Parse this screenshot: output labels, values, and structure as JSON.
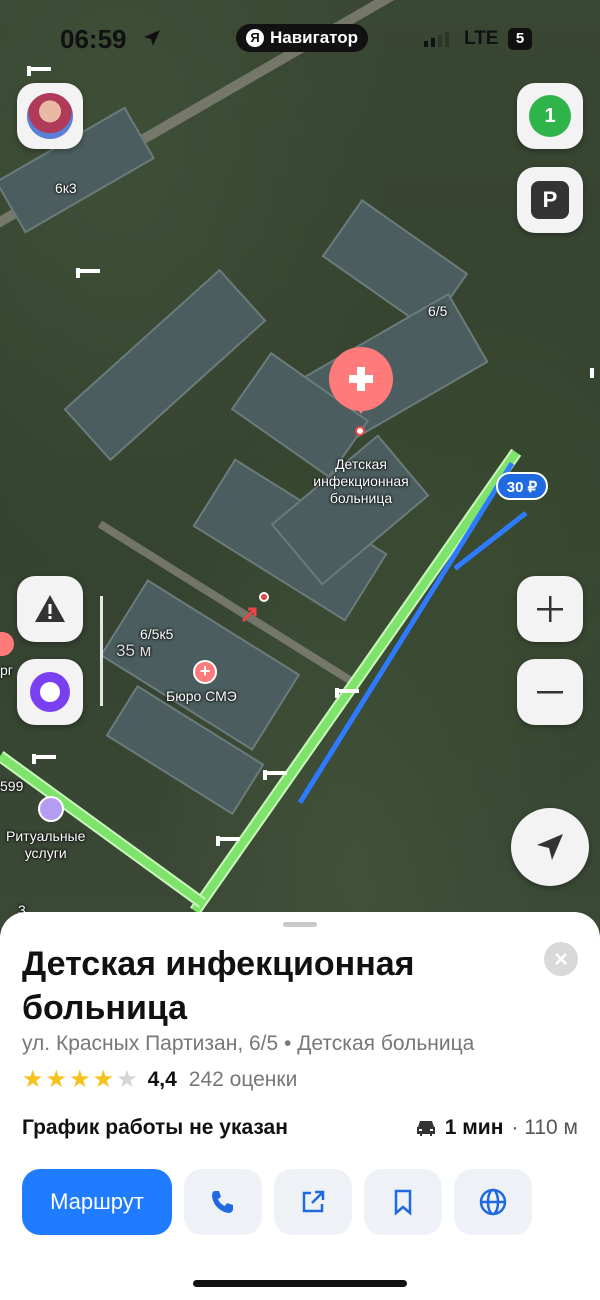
{
  "status_bar": {
    "time": "06:59",
    "app_pill": "Навигатор",
    "app_logo": "Я",
    "network": "LTE",
    "battery": "5"
  },
  "map": {
    "labels": {
      "building_6k3": "6к3",
      "building_6_5": "6/5",
      "poi_hospital": "Детская\nинфекционная\nбольница",
      "building_6_5k5": "6/5к5",
      "poi_bureau": "Бюро СМЭ",
      "poi_funeral": "Ритуальные\nуслуги",
      "scale": "35 м",
      "edge_org": "рг",
      "edge_599": "599",
      "edge_3": "3"
    },
    "price_badge": "30 ₽",
    "traffic_badge": "1",
    "parking_label": "P",
    "icons": [
      "avatar-icon",
      "traffic-icon",
      "parking-icon",
      "alert-icon",
      "alice-icon",
      "zoom-in-icon",
      "zoom-out-icon",
      "location-arrow-icon",
      "hospital-icon",
      "barrier-icon"
    ]
  },
  "place": {
    "title": "Детская инфекционная больница",
    "address": "ул. Красных Партизан, 6/5 • Детская больница",
    "rating": "4,4",
    "rating_value": 4.4,
    "reviews": "242 оценки",
    "hours": "График работы не указан",
    "travel_time": "1 мин",
    "travel_distance": "· 110 м"
  },
  "actions": {
    "route_label": "Маршрут"
  },
  "colors": {
    "accent": "#1f7bff",
    "pin": "#ff7b7b",
    "route": "#7ee36a",
    "star": "#f6c21b"
  }
}
